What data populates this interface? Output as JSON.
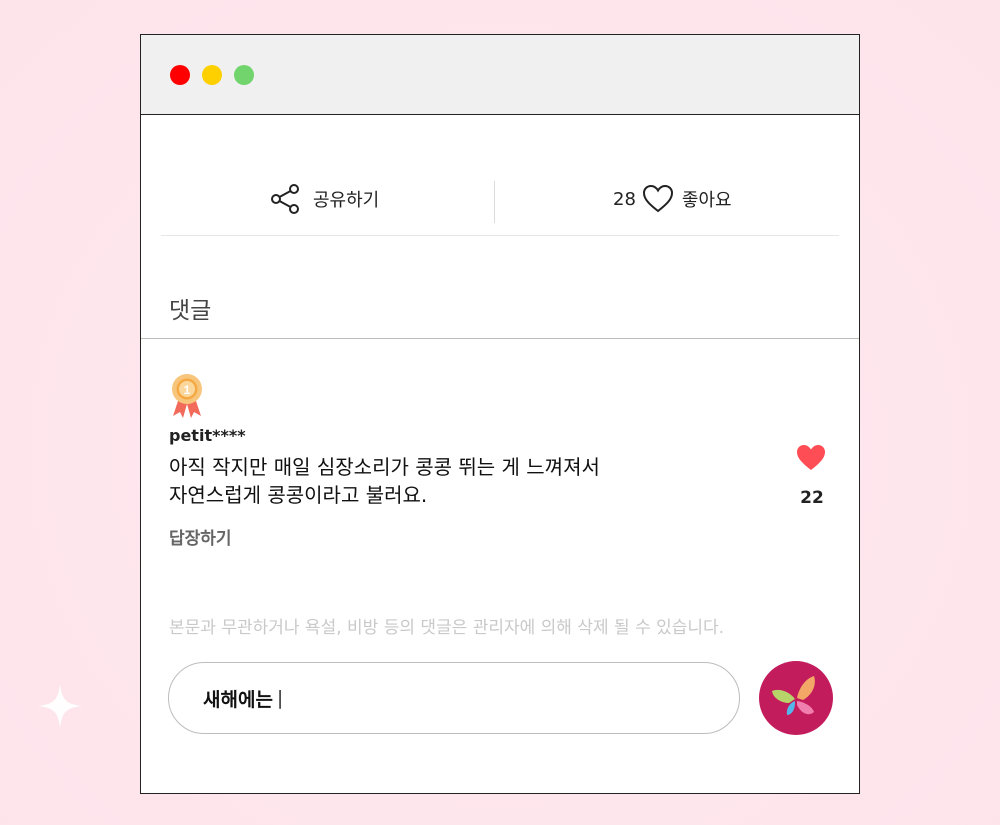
{
  "actions": {
    "share_label": "공유하기",
    "like_count": "28",
    "like_label": "좋아요"
  },
  "comments_section": {
    "title": "댓글"
  },
  "comment": {
    "rank": "1",
    "username": "petit****",
    "text_lines": [
      "아직 작지만 매일 심장소리가 콩콩 뛰는 게 느껴져서",
      "자연스럽게 콩콩이라고 불러요."
    ],
    "like_count": "22",
    "reply_label": "답장하기"
  },
  "notice": "본문과 무관하거나 욕설, 비방 등의 댓글은 관리자에 의해 삭제 될 수 있습니다.",
  "input": {
    "value": "새해에는",
    "caret": "|"
  },
  "colors": {
    "accent": "#c31c5c",
    "heart": "#ff4d55",
    "dot_red": "#ff0000",
    "dot_yellow": "#ffd000",
    "dot_green": "#72d46c"
  }
}
